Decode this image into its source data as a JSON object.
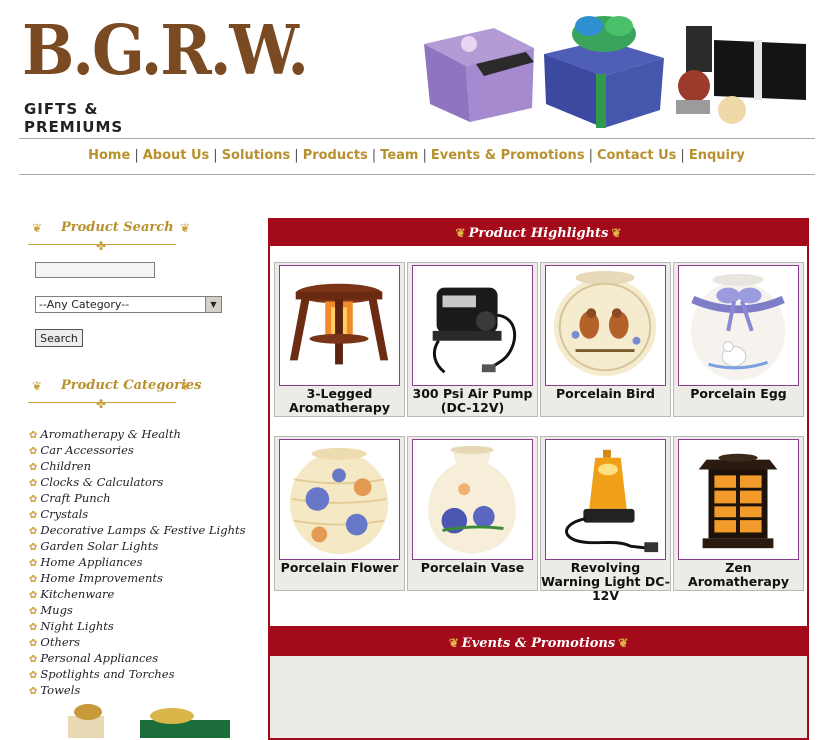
{
  "brand": {
    "name": "B.G.R.W.",
    "tagline": "GIFTS & PREMIUMS"
  },
  "nav": [
    "Home",
    "About Us",
    "Solutions",
    "Products",
    "Team",
    "Events & Promotions",
    "Contact Us",
    "Enquiry"
  ],
  "sidebar": {
    "search_title": "Product Search",
    "search_value": "",
    "category_selected": "--Any Category--",
    "search_button": "Search",
    "categories_title": "Product Categories",
    "categories": [
      "Aromatherapy & Health",
      "Car Accessories",
      "Children",
      "Clocks & Calculators",
      "Craft Punch",
      "Crystals",
      "Decorative Lamps & Festive Lights",
      "Garden Solar Lights",
      "Home Appliances",
      "Home Improvements",
      "Kitchenware",
      "Mugs",
      "Night Lights",
      "Others",
      "Personal Appliances",
      "Spotlights and Torches",
      "Towels"
    ]
  },
  "highlights": {
    "title": "Product Highlights",
    "products": [
      {
        "name": "3-Legged Aromatherapy",
        "icon": "aromatherapy-stand-image"
      },
      {
        "name": "300 Psi Air Pump (DC-12V)",
        "icon": "air-pump-image"
      },
      {
        "name": "Porcelain Bird",
        "icon": "porcelain-bird-image"
      },
      {
        "name": "Porcelain Egg",
        "icon": "porcelain-egg-image"
      },
      {
        "name": "Porcelain Flower",
        "icon": "porcelain-flower-image"
      },
      {
        "name": "Porcelain Vase",
        "icon": "porcelain-vase-image"
      },
      {
        "name": "Revolving Warning Light DC-12V",
        "icon": "warning-light-image"
      },
      {
        "name": "Zen Aromatherapy",
        "icon": "zen-lamp-image"
      }
    ]
  },
  "events": {
    "title": "Events & Promotions"
  },
  "colors": {
    "accent": "#a30a1a",
    "gold": "#b8912e",
    "brown": "#7a4a22"
  }
}
